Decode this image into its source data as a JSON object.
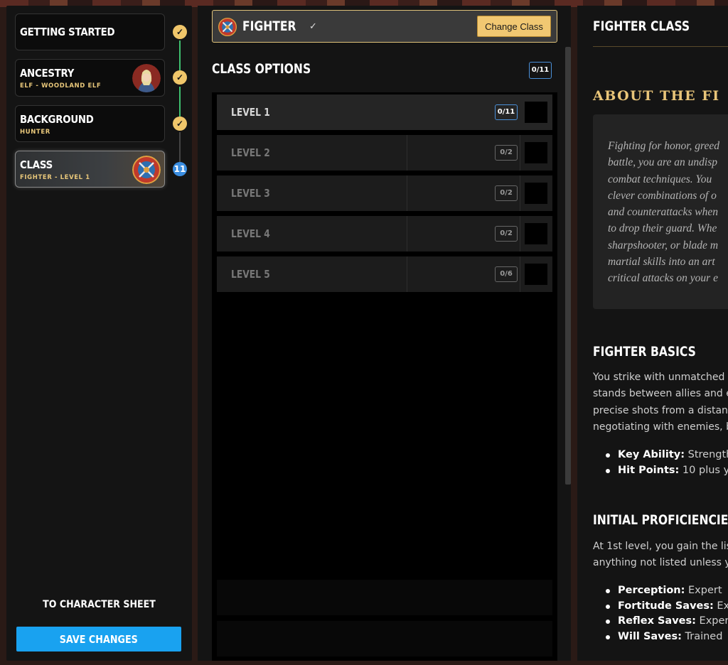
{
  "sidebar": {
    "steps": [
      {
        "title": "GETTING STARTED",
        "sub": "",
        "status": "check"
      },
      {
        "title": "ANCESTRY",
        "sub": "ELF - WOODLAND ELF",
        "status": "check"
      },
      {
        "title": "BACKGROUND",
        "sub": "HUNTER",
        "status": "check"
      },
      {
        "title": "CLASS",
        "sub": "FIGHTER - LEVEL 1",
        "status": "11"
      }
    ],
    "to_sheet": "TO CHARACTER SHEET",
    "save": "SAVE CHANGES"
  },
  "middle": {
    "class_name": "FIGHTER",
    "change_btn": "Change Class",
    "options_title": "CLASS OPTIONS",
    "options_count": "0/11",
    "levels": [
      {
        "label": "LEVEL 1",
        "count": "0/11"
      },
      {
        "label": "LEVEL 2",
        "count": "0/2"
      },
      {
        "label": "LEVEL 3",
        "count": "0/2"
      },
      {
        "label": "LEVEL 4",
        "count": "0/2"
      },
      {
        "label": "LEVEL 5",
        "count": "0/6"
      }
    ]
  },
  "right": {
    "title": "FIGHTER CLASS",
    "about": "ABOUT THE FI",
    "quote": "Fighting for honor, greed\nbattle, you are an undisp\ncombat techniques. You\nclever combinations of o\nand counterattacks when\nto drop their guard. Whe\nsharpshooter, or blade m\nmartial skills into an art\ncritical attacks on your e",
    "basics_title": "FIGHTER BASICS",
    "basics_text": "You strike with unmatched a\nstands between allies and e\nprecise shots from a distanc\nnegotiating with enemies, b",
    "basics_items": [
      {
        "label": "Key Ability:",
        "value": " Strength"
      },
      {
        "label": "Hit Points:",
        "value": " 10 plus yo"
      }
    ],
    "prof_title": "INITIAL PROFICIENCIES",
    "prof_text": "At 1st level, you gain the lis\nanything not listed unless y",
    "prof_items": [
      {
        "label": "Perception:",
        "value": " Expert"
      },
      {
        "label": "Fortitude Saves:",
        "value": " Exp"
      },
      {
        "label": "Reflex Saves:",
        "value": " Expert"
      },
      {
        "label": "Will Saves:",
        "value": " Trained"
      }
    ]
  },
  "colors": {
    "accent_gold": "#f1c872",
    "accent_blue": "#19a2f0",
    "badge_blue": "#3a8de0"
  }
}
